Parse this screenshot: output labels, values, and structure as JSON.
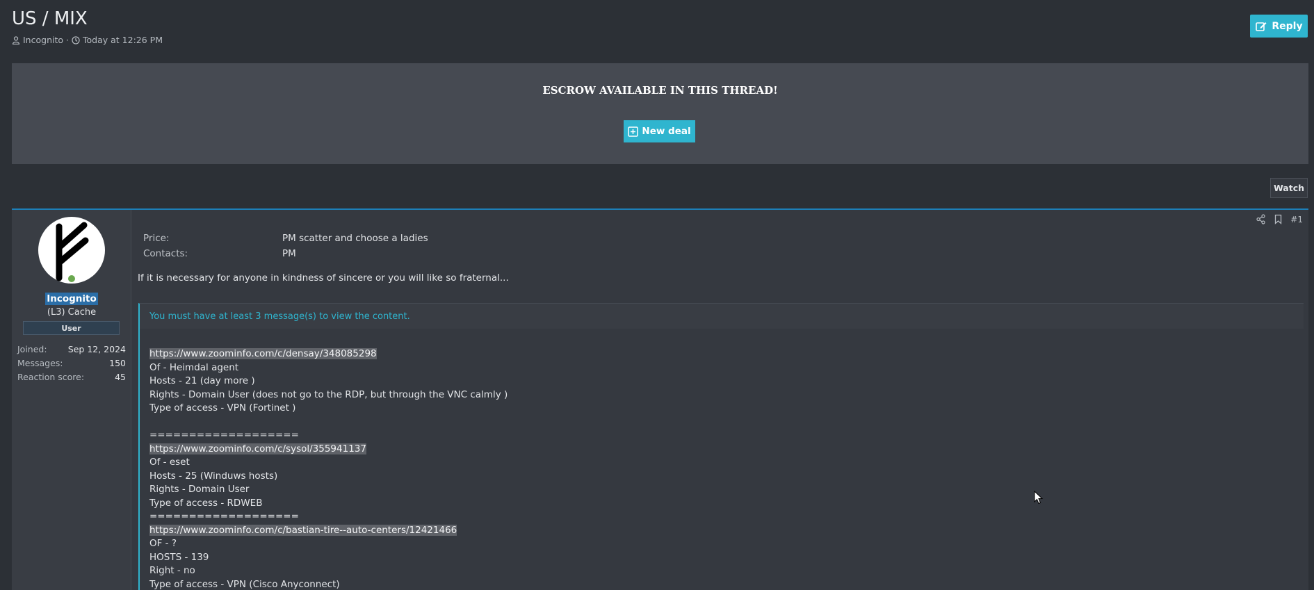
{
  "header": {
    "title": "US / MIX",
    "author": "Incognito",
    "separator": "·",
    "timestamp": "Today at 12:26 PM",
    "reply_label": "Reply"
  },
  "escrow": {
    "title": "ESCROW AVAILABLE IN THIS THREAD!",
    "new_deal_label": "New deal"
  },
  "watch_label": "Watch",
  "post": {
    "number": "#1",
    "user": {
      "name": "Incognito",
      "title": "(L3) Cache",
      "banner": "User",
      "stats": [
        {
          "label": "Joined:",
          "value": "Sep 12, 2024"
        },
        {
          "label": "Messages:",
          "value": "150"
        },
        {
          "label": "Reaction score:",
          "value": "45"
        }
      ]
    },
    "fields": [
      {
        "label": "Price:",
        "value": "PM scatter and choose a ladies"
      },
      {
        "label": "Contacts:",
        "value": "PM"
      }
    ],
    "intro": "If it is necessary for anyone in kindness of sincere or you will like so fraternal...",
    "hidden_notice": "You must have at least 3 message(s) to view the content.",
    "lines": [
      "https://www.zoominfo.com/c/densay/348085298",
      "Of - Heimdal agent",
      "Hosts - 21 (day more )",
      "Rights - Domain User (does not go to the RDP, but through the VNC calmly )",
      "Type of access - VPN (Fortinet )",
      "",
      "===================",
      "https://www.zoominfo.com/c/sysol/355941137",
      "Of - eset",
      "Hosts - 25 (Winduws hosts)",
      "Rights - Domain User",
      "Type of access - RDWEB",
      "===================",
      "https://www.zoominfo.com/c/bastian-tire--auto-centers/12421466",
      "OF - ?",
      "HOSTS - 139",
      "Right - no",
      "Type of access - VPN (Cisco Anyconnect)"
    ]
  }
}
